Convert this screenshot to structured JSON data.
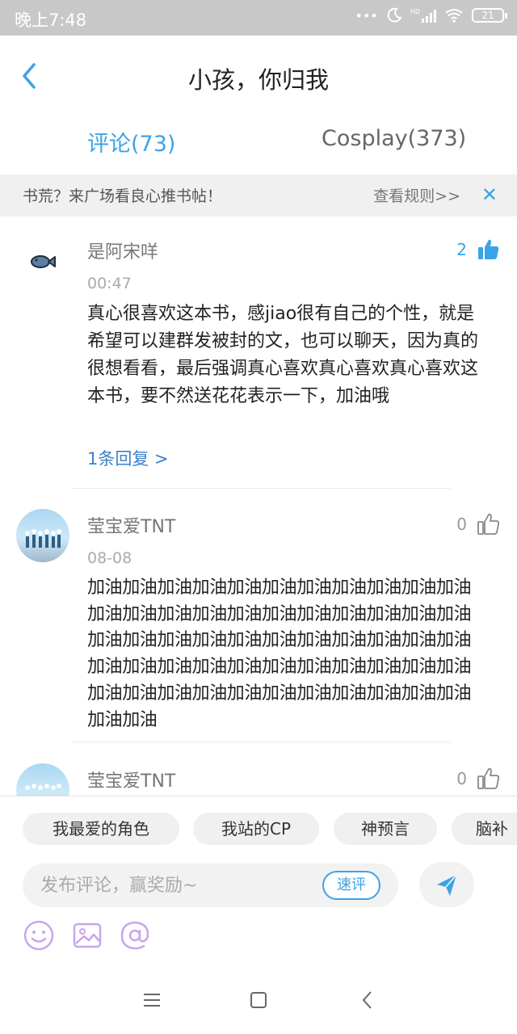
{
  "status_bar": {
    "time": "晚上7:48",
    "signal_label": "HD",
    "battery": "21"
  },
  "header": {
    "title": "小孩，你归我"
  },
  "tabs": [
    {
      "label": "评论(73)",
      "active": true
    },
    {
      "label": "Cosplay(373)",
      "active": false
    }
  ],
  "banner": {
    "text": "书荒？来广场看良心推书帖！",
    "rules_link": "查看规则>>",
    "close": "✕"
  },
  "comments": [
    {
      "username": "是阿宋咩",
      "time": "00:47",
      "likes": "2",
      "liked": true,
      "text": "真心很喜欢这本书，感jiao很有自己的个性，就是希望可以建群发被封的文，也可以聊天，因为真的很想看看，最后强调真心喜欢真心喜欢真心喜欢这本书，要不然送花花表示一下，加油哦",
      "reply_link": "1条回复 >"
    },
    {
      "username": "莹宝爱TNT",
      "time": "08-08",
      "likes": "0",
      "liked": false,
      "text": "加油加油加油加油加油加油加油加油加油加油加油加油加油加油加油加油加油加油加油加油加油加油加油加油加油加油加油加油加油加油加油加油加油加油加油加油加油加油加油加油加油加油加油加油加油加油加油加油加油加油加油加油加油加油加油加油加油"
    },
    {
      "username": "莹宝爱TNT",
      "likes": "0",
      "liked": false
    }
  ],
  "quick_tags": [
    "我最爱的角色",
    "我站的CP",
    "神预言",
    "脑补"
  ],
  "composer": {
    "placeholder": "发布评论，赢奖励~",
    "quick_comment": "速评"
  },
  "colors": {
    "accent": "#3ba3e6",
    "link": "#3a82c9",
    "tool_icon": "#c9a6e8"
  }
}
